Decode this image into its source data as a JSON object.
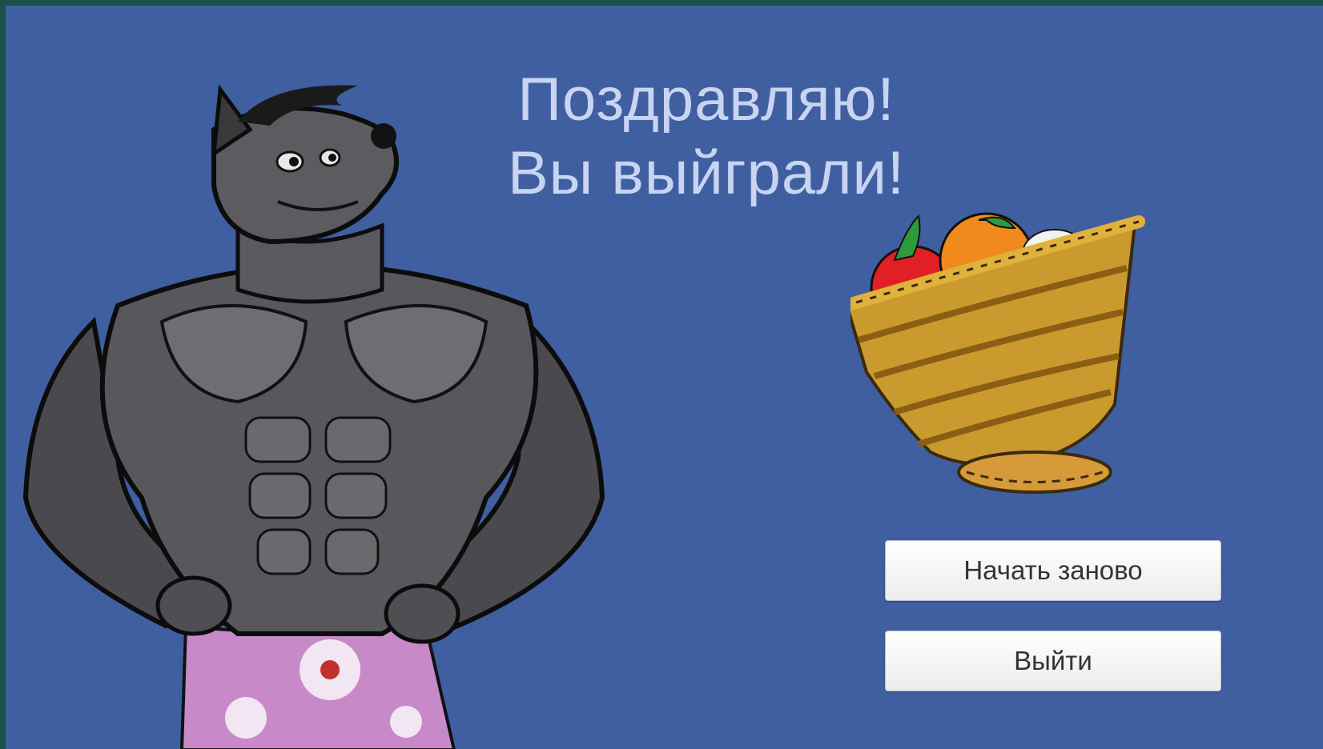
{
  "screen": {
    "title_line1": "Поздравляю!",
    "title_line2": "Вы выйграли!",
    "background_color": "#3f5fa0",
    "title_color": "#c8d4f2"
  },
  "buttons": {
    "restart_label": "Начать заново",
    "exit_label": "Выйти"
  },
  "images": {
    "character": "muscular-wolf-character",
    "basket": "fruit-basket-apple-orange-egg"
  }
}
